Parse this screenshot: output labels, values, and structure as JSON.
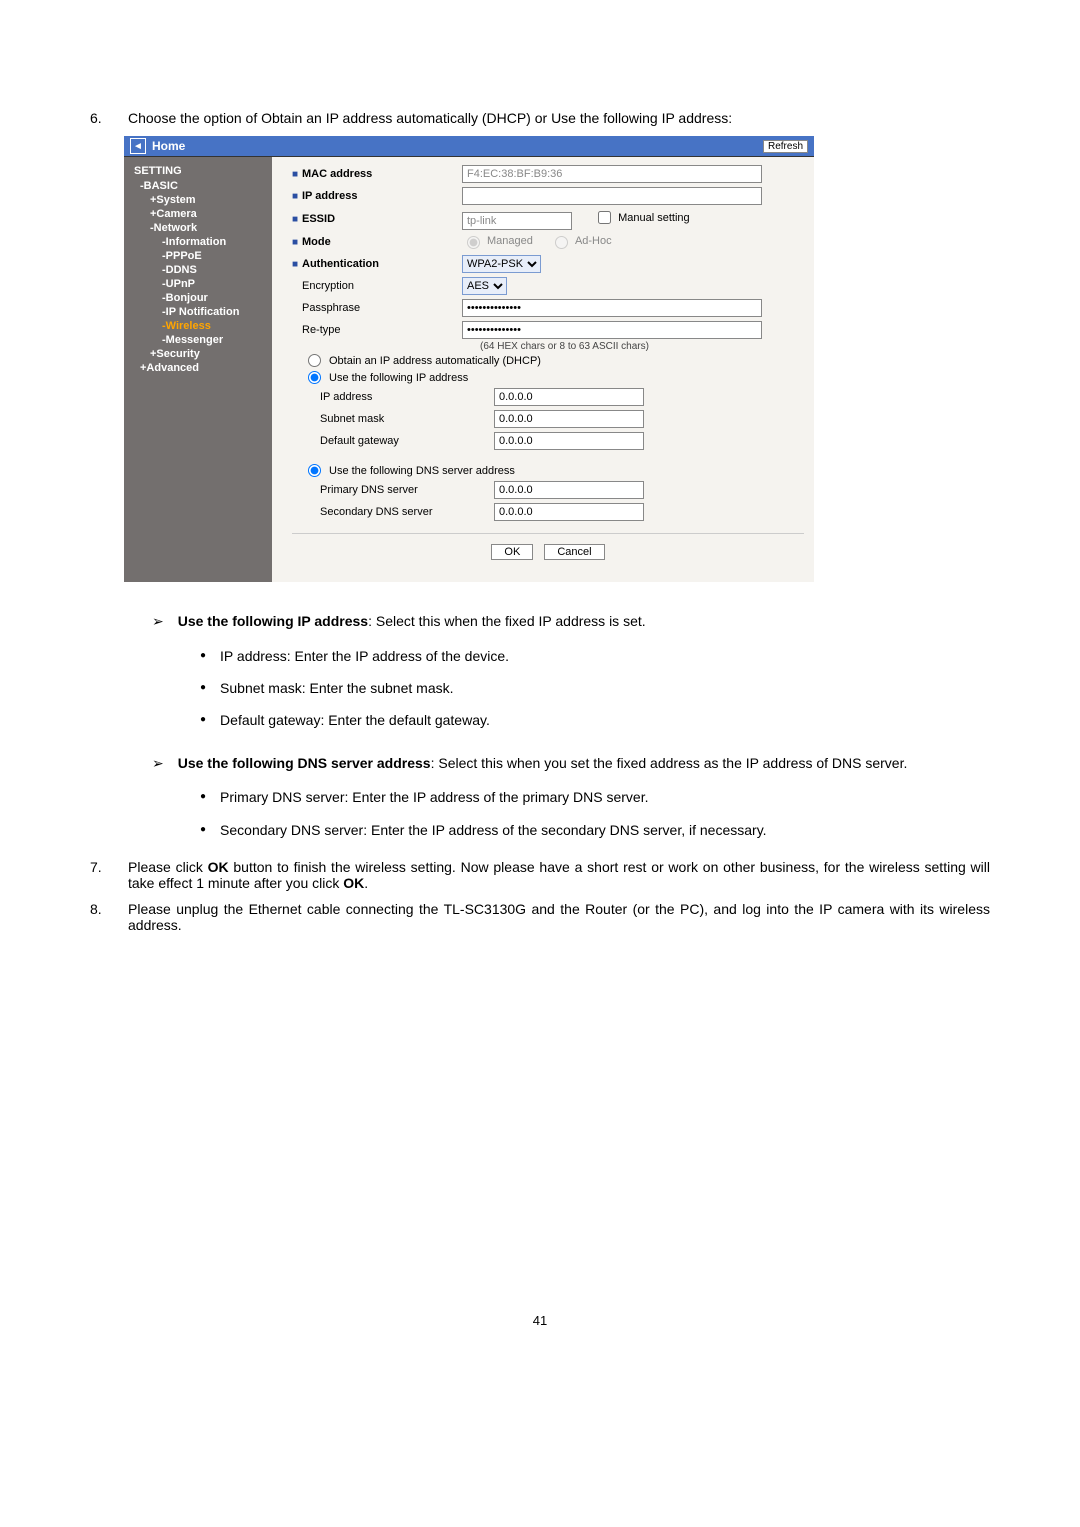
{
  "doc": {
    "step6_num": "6.",
    "step6_text_a": "Choose the option of Obtain an IP address automatically (DHCP) or Use the following IP address:",
    "step7_num": "7.",
    "step7_a": "Please click ",
    "step7_b_bold": "OK",
    "step7_c": " button to finish the wireless setting. Now please have a short rest or work on other business, for the wireless setting will take effect 1 minute after you click ",
    "step7_d_bold": "OK",
    "step7_e": ".",
    "step8_num": "8.",
    "step8_text": "Please unplug the Ethernet cable connecting the TL-SC3130G and the Router (or the PC), and log into the IP camera with its wireless address.",
    "arrow1_bold": "Use the following IP address",
    "arrow1_rest": ": Select this when the fixed IP address is set.",
    "a1_b1": "IP address: Enter the IP address of the device.",
    "a1_b2": "Subnet mask: Enter the subnet mask.",
    "a1_b3": "Default gateway: Enter the default gateway.",
    "arrow2_bold": "Use the following DNS server address",
    "arrow2_rest": ": Select this when you set the fixed address as the IP address of DNS server.",
    "a2_b1": "Primary DNS server: Enter the IP address of the primary DNS server.",
    "a2_b2": "Secondary DNS server: Enter the IP address of the secondary DNS server, if necessary.",
    "page_num": "41"
  },
  "ui": {
    "header": {
      "home": "Home",
      "refresh": "Refresh"
    },
    "sidebar": {
      "setting": "SETTING",
      "basic": "-BASIC",
      "system": "+System",
      "camera": "+Camera",
      "network": "-Network",
      "information": "-Information",
      "pppoe": "-PPPoE",
      "ddns": "-DDNS",
      "upnp": "-UPnP",
      "bonjour": "-Bonjour",
      "ipnotif": "-IP Notification",
      "wireless": "-Wireless",
      "messenger": "-Messenger",
      "security": "+Security",
      "advanced": "+Advanced"
    },
    "labels": {
      "mac": "MAC address",
      "ip": "IP address",
      "essid": "ESSID",
      "mode": "Mode",
      "auth": "Authentication",
      "enc": "Encryption",
      "pass": "Passphrase",
      "retype": "Re-type",
      "hint": "(64 HEX chars or 8 to 63 ASCII chars)",
      "dhcp": "Obtain an IP address automatically (DHCP)",
      "useip": "Use the following IP address",
      "ipaddress": "IP address",
      "subnet": "Subnet mask",
      "gateway": "Default gateway",
      "usedns": "Use the following DNS server address",
      "primdns": "Primary DNS server",
      "secdns": "Secondary DNS server",
      "managed": "Managed",
      "adhoc": "Ad-Hoc",
      "manual": "Manual setting",
      "ok": "OK",
      "cancel": "Cancel"
    },
    "values": {
      "mac": "F4:EC:38:BF:B9:36",
      "essid": "tp-link",
      "auth": "WPA2-PSK",
      "enc": "AES",
      "pass": "••••••••••••••",
      "retype": "••••••••••••••",
      "ip": "0.0.0.0",
      "subnet": "0.0.0.0",
      "gateway": "0.0.0.0",
      "primdns": "0.0.0.0",
      "secdns": "0.0.0.0"
    }
  }
}
